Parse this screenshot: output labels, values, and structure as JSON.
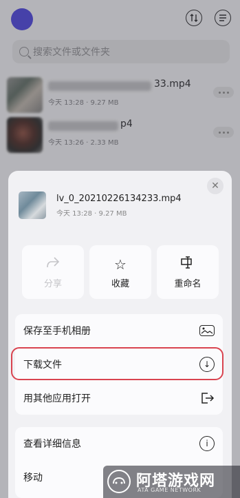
{
  "header": {
    "avatar_color": "#4b44d6",
    "icons": [
      "sort-icon",
      "menu-icon"
    ]
  },
  "search": {
    "placeholder": "搜索文件或文件夹"
  },
  "files": [
    {
      "name_suffix": "33.mp4",
      "meta": "今天 13:28 · 9.27 MB"
    },
    {
      "name_suffix": "p4",
      "meta": "今天 13:26 · 2.33 MB"
    }
  ],
  "sheet": {
    "file_name": "lv_0_20210226134233.mp4",
    "file_meta": "今天 13:28 · 9.27 MB",
    "actions": [
      {
        "label": "分享",
        "icon": "share-icon",
        "enabled": false
      },
      {
        "label": "收藏",
        "icon": "star-icon",
        "enabled": true
      },
      {
        "label": "重命名",
        "icon": "rename-icon",
        "enabled": true
      }
    ],
    "menu_group1": [
      {
        "label": "保存至手机相册",
        "icon": "picture-icon"
      },
      {
        "label": "下载文件",
        "icon": "download-icon",
        "highlighted": true
      },
      {
        "label": "用其他应用打开",
        "icon": "open-with-icon"
      }
    ],
    "menu_group2": [
      {
        "label": "查看详细信息",
        "icon": "info-icon"
      },
      {
        "label": "移动"
      }
    ]
  },
  "watermark": {
    "name": "阿塔游戏网",
    "sub": "ATA GAME NETWORK"
  },
  "colors": {
    "highlight": "#d9434f",
    "accent": "#4b44d6"
  }
}
